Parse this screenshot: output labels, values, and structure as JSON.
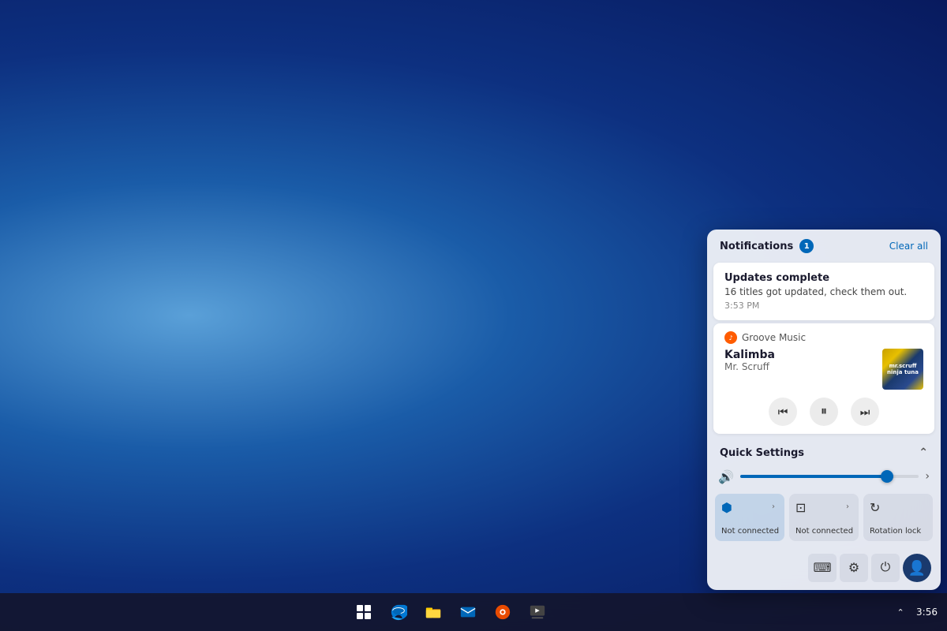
{
  "desktop": {
    "background_description": "Windows 11 blue gradient desktop"
  },
  "taskbar": {
    "icons": [
      {
        "name": "start-button",
        "label": "Start",
        "symbol": "⊞"
      },
      {
        "name": "edge-button",
        "label": "Microsoft Edge",
        "symbol": "🌐"
      },
      {
        "name": "file-explorer-button",
        "label": "File Explorer",
        "symbol": "📁"
      },
      {
        "name": "mail-button",
        "label": "Mail",
        "symbol": "✉"
      },
      {
        "name": "groove-music-button",
        "label": "Groove Music",
        "symbol": "🎵"
      },
      {
        "name": "media-player-button",
        "label": "Media Player",
        "symbol": "▶"
      }
    ],
    "clock": {
      "time": "3:56",
      "date": ""
    }
  },
  "action_center": {
    "notifications": {
      "header": "Notifications",
      "badge_count": "1",
      "clear_all_label": "Clear all",
      "items": [
        {
          "title": "Updates complete",
          "body": "16 titles got updated, check them out.",
          "time": "3:53 PM"
        }
      ]
    },
    "music_player": {
      "app_name": "Groove Music",
      "track": "Kalimba",
      "artist": "Mr. Scruff",
      "album_art_line1": "mr.scruff",
      "album_art_line2": "ninja tuna",
      "controls": {
        "prev": "⏮",
        "pause": "⏸",
        "next": "⏭"
      }
    },
    "quick_settings": {
      "header": "Quick Settings",
      "volume": {
        "icon": "🔊",
        "level": 82
      },
      "tiles": [
        {
          "icon": "bluetooth",
          "label": "Not connected",
          "active": true
        },
        {
          "icon": "display",
          "label": "Not connected",
          "active": false
        },
        {
          "icon": "rotation",
          "label": "Rotation lock",
          "active": false
        }
      ],
      "bottom_buttons": [
        {
          "name": "keyboard-button",
          "symbol": "⌨"
        },
        {
          "name": "settings-button",
          "symbol": "⚙"
        },
        {
          "name": "power-button",
          "symbol": "⏻"
        },
        {
          "name": "account-button",
          "symbol": "👤"
        }
      ]
    }
  }
}
